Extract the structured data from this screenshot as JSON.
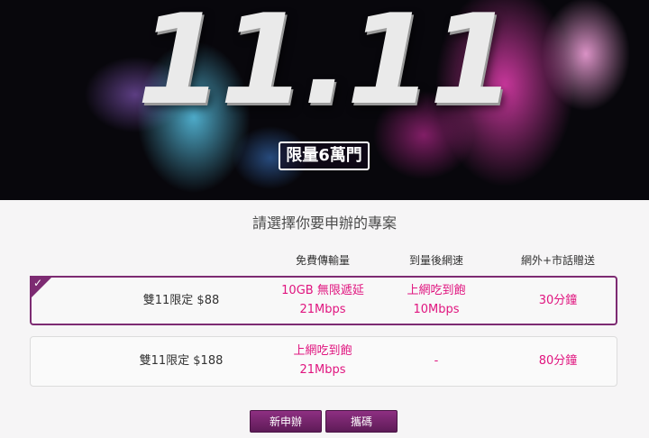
{
  "hero": {
    "title": "11.11",
    "badge": "限量6萬門"
  },
  "prompt": "請選擇你要申辦的專案",
  "columns": {
    "data": "免費傳輸量",
    "speed": "到量後網速",
    "voice": "網外+市話贈送"
  },
  "plans": [
    {
      "name": "雙11限定 $88",
      "data_line1": "10GB 無限遞延",
      "data_line2": "21Mbps",
      "speed_line1": "上網吃到飽",
      "speed_line2": "10Mbps",
      "voice": "30分鐘",
      "selected": true
    },
    {
      "name": "雙11限定 $188",
      "data_line1": "上網吃到飽",
      "data_line2": "21Mbps",
      "speed_line1": "-",
      "voice": "80分鐘",
      "selected": false
    }
  ],
  "buttons": {
    "new": "新申辦",
    "port": "攜碼"
  },
  "colors": {
    "accent": "#7d2b72",
    "highlight": "#e0157f"
  },
  "icons": {
    "selected_marker": "check-icon"
  }
}
